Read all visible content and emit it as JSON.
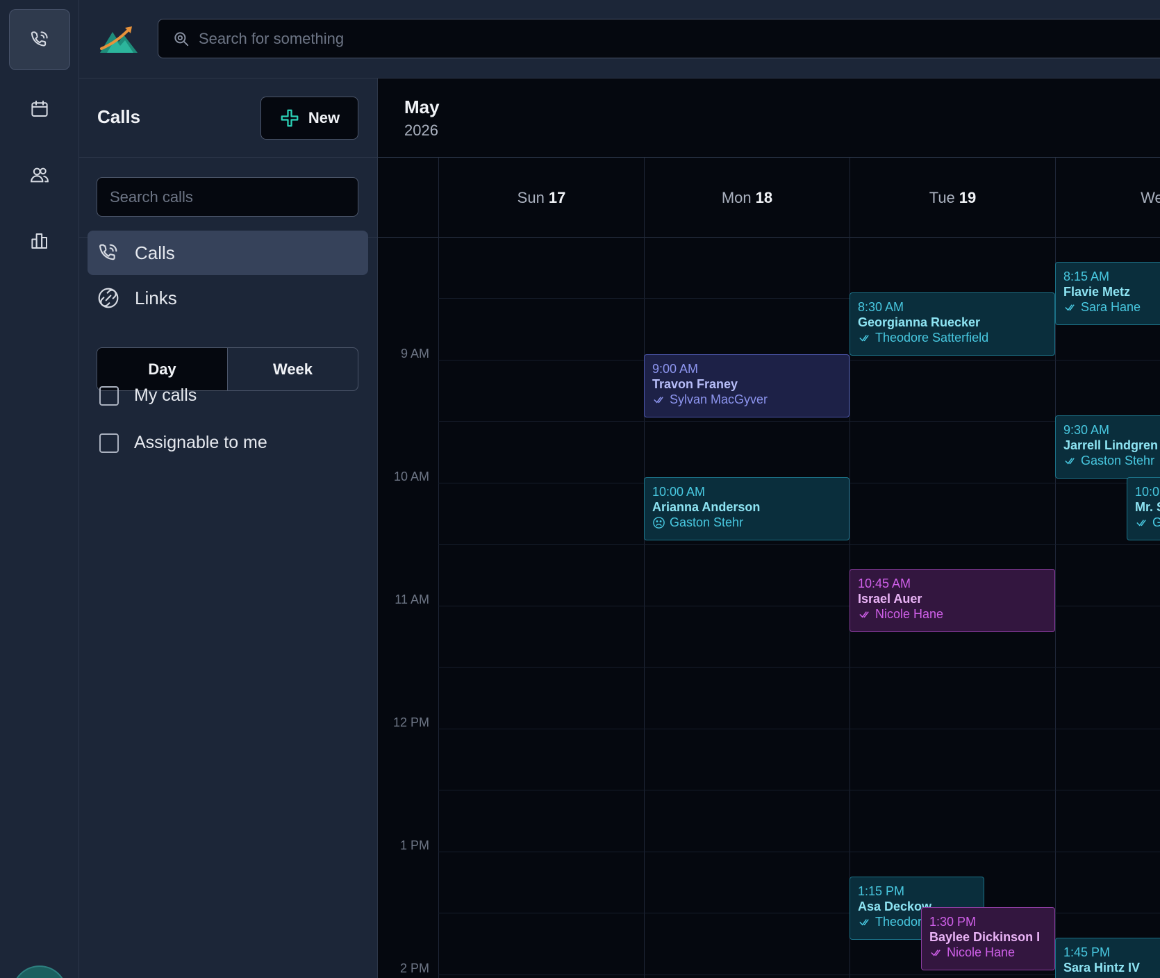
{
  "search": {
    "placeholder": "Search for something"
  },
  "panel": {
    "title": "Calls",
    "new_label": "New",
    "search_placeholder": "Search calls",
    "nav": [
      {
        "label": "Calls",
        "icon": "phone-icon",
        "active": true
      },
      {
        "label": "Links",
        "icon": "link-icon",
        "active": false
      }
    ],
    "view_toggle": [
      {
        "label": "Day",
        "active": true
      },
      {
        "label": "Week",
        "active": false
      }
    ],
    "filters": [
      {
        "label": "My calls",
        "checked": false
      },
      {
        "label": "Assignable to me",
        "checked": false
      }
    ]
  },
  "calendar": {
    "month": "May",
    "year": "2026",
    "days": [
      {
        "name": "Sun",
        "num": "17"
      },
      {
        "name": "Mon",
        "num": "18"
      },
      {
        "name": "Tue",
        "num": "19"
      },
      {
        "name": "Wed",
        "num": ""
      }
    ],
    "times": [
      "9 AM",
      "10 AM",
      "11 AM",
      "12 PM",
      "1 PM",
      "2 PM"
    ],
    "events": [
      {
        "time": "8:15 AM",
        "name": "Flavie Metz",
        "assignee": "Sara Hane",
        "status": "check",
        "color": "teal"
      },
      {
        "time": "8:30 AM",
        "name": "Georgianna Ruecker",
        "assignee": "Theodore Satterfield",
        "status": "check",
        "color": "teal"
      },
      {
        "time": "9:00 AM",
        "name": "Travon Franey",
        "assignee": "Sylvan MacGyver",
        "status": "check",
        "color": "indigo"
      },
      {
        "time": "9:30 AM",
        "name": "Jarrell Lindgren",
        "assignee": "Gaston Stehr",
        "status": "check",
        "color": "teal"
      },
      {
        "time": "10:00 AM",
        "name": "Arianna Anderson",
        "assignee": "Gaston Stehr",
        "status": "frown",
        "color": "teal"
      },
      {
        "time": "10:0",
        "name": "Mr. S",
        "assignee": "G",
        "status": "check",
        "color": "teal"
      },
      {
        "time": "10:45 AM",
        "name": "Israel Auer",
        "assignee": "Nicole Hane",
        "status": "check",
        "color": "purple"
      },
      {
        "time": "1:15 PM",
        "name": "Asa Deckow",
        "assignee": "Theodore",
        "status": "check",
        "color": "teal"
      },
      {
        "time": "1:30 PM",
        "name": "Baylee Dickinson I",
        "assignee": "Nicole Hane",
        "status": "check",
        "color": "purple"
      },
      {
        "time": "1:45 PM",
        "name": "Sara Hintz IV",
        "assignee": "",
        "status": "check",
        "color": "teal"
      }
    ]
  }
}
